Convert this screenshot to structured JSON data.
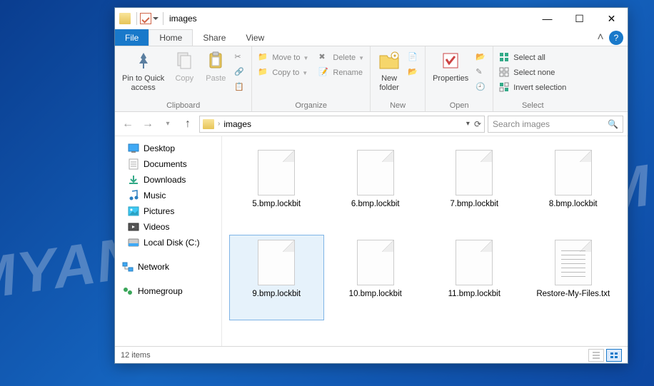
{
  "titlebar": {
    "title": "images"
  },
  "window_controls": {
    "minimize": "—",
    "maximize": "☐",
    "close": "✕"
  },
  "tabs": {
    "file": "File",
    "home": "Home",
    "share": "Share",
    "view": "View"
  },
  "ribbon": {
    "clipboard": {
      "label": "Clipboard",
      "pin": "Pin to Quick\naccess",
      "copy": "Copy",
      "paste": "Paste"
    },
    "organize": {
      "label": "Organize",
      "moveto": "Move to",
      "copyto": "Copy to",
      "delete": "Delete",
      "rename": "Rename"
    },
    "new": {
      "label": "New",
      "newfolder": "New\nfolder"
    },
    "open": {
      "label": "Open",
      "properties": "Properties"
    },
    "select": {
      "label": "Select",
      "selectall": "Select all",
      "selectnone": "Select none",
      "invert": "Invert selection"
    }
  },
  "addressbar": {
    "crumb1": "images",
    "search_placeholder": "Search images"
  },
  "sidebar": {
    "items": [
      {
        "label": "Desktop"
      },
      {
        "label": "Documents"
      },
      {
        "label": "Downloads"
      },
      {
        "label": "Music"
      },
      {
        "label": "Pictures"
      },
      {
        "label": "Videos"
      },
      {
        "label": "Local Disk (C:)"
      }
    ],
    "network": "Network",
    "homegroup": "Homegroup"
  },
  "files": [
    {
      "name": "5.bmp.lockbit",
      "type": "blank"
    },
    {
      "name": "6.bmp.lockbit",
      "type": "blank"
    },
    {
      "name": "7.bmp.lockbit",
      "type": "blank"
    },
    {
      "name": "8.bmp.lockbit",
      "type": "blank"
    },
    {
      "name": "9.bmp.lockbit",
      "type": "blank",
      "selected": true
    },
    {
      "name": "10.bmp.lockbit",
      "type": "blank"
    },
    {
      "name": "11.bmp.lockbit",
      "type": "blank"
    },
    {
      "name": "Restore-My-Files.txt",
      "type": "txt"
    }
  ],
  "statusbar": {
    "count": "12 items"
  },
  "watermark": "MYANTISPYWARE.COM"
}
